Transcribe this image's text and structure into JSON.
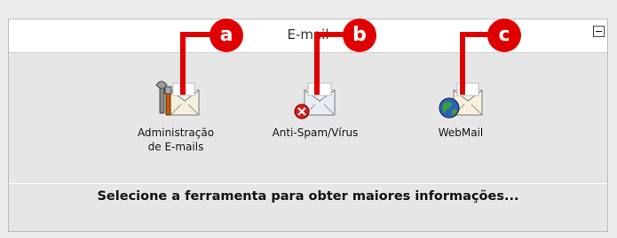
{
  "panel": {
    "title": "E-mail",
    "collapse_icon": "minus-box-icon",
    "tools": [
      {
        "label_line1": "Administração",
        "label_line2": "de E-mails",
        "icon": "tools-envelope-icon"
      },
      {
        "label_line1": "Anti-Spam/Vírus",
        "label_line2": "",
        "icon": "blocked-envelope-icon"
      },
      {
        "label_line1": "WebMail",
        "label_line2": "",
        "icon": "globe-envelope-icon"
      }
    ],
    "message": "Selecione a ferramenta para obter maiores informações..."
  },
  "callouts": [
    {
      "letter": "a",
      "color": "#e00000"
    },
    {
      "letter": "b",
      "color": "#e00000"
    },
    {
      "letter": "c",
      "color": "#e00000"
    }
  ]
}
